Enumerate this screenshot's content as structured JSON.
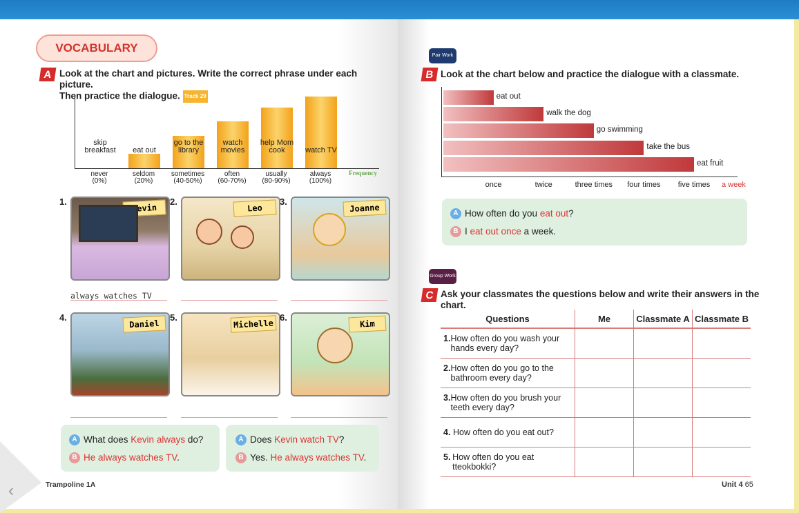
{
  "left_page": {
    "vocab_title": "VOCABULARY",
    "section_a": {
      "badge": "A",
      "line1": "Look at the chart and pictures. Write the correct phrase under each picture.",
      "line2": "Then practice the dialogue.",
      "track": "Track 29"
    },
    "frequency_label": "Frequency",
    "footer": "Trampoline 1A",
    "pictures": [
      {
        "num": "1.",
        "name": "Kevin",
        "answer": "always watches TV"
      },
      {
        "num": "2.",
        "name": "Leo",
        "answer": ""
      },
      {
        "num": "3.",
        "name": "Joanne",
        "answer": ""
      },
      {
        "num": "4.",
        "name": "Daniel",
        "answer": ""
      },
      {
        "num": "5.",
        "name": "Michelle",
        "answer": ""
      },
      {
        "num": "6.",
        "name": "Kim",
        "answer": ""
      }
    ],
    "dialogue1": {
      "q_prefix": "What does ",
      "q_highlight": "Kevin always",
      "q_suffix": " do?",
      "a_highlight": "He always watches TV",
      "a_suffix": "."
    },
    "dialogue2": {
      "q_prefix": "Does ",
      "q_highlight": "Kevin watch TV",
      "q_suffix": "?",
      "a_prefix": "Yes. ",
      "a_highlight": "He always watches TV",
      "a_suffix": "."
    }
  },
  "right_page": {
    "pair_work": "Pair Work",
    "group_work": "Group Work",
    "section_b": {
      "badge": "B",
      "text": "Look at the chart below and practice the dialogue with a classmate."
    },
    "dialogue_b": {
      "q_prefix": "How often do you ",
      "q_highlight": "eat out",
      "q_suffix": "?",
      "a_prefix": "I ",
      "a_highlight": "eat out once",
      "a_suffix": " a week."
    },
    "section_c": {
      "badge": "C",
      "text": "Ask your classmates the questions below and write their answers in the chart."
    },
    "table_headers": [
      "Questions",
      "Me",
      "Classmate A",
      "Classmate B"
    ],
    "questions": [
      {
        "num": "1.",
        "text": "How often do you wash your hands every day?"
      },
      {
        "num": "2.",
        "text": "How often do you go to the bathroom every day?"
      },
      {
        "num": "3.",
        "text": "How often do you brush your teeth every day?"
      },
      {
        "num": "4.",
        "text": "How often do you eat out?"
      },
      {
        "num": "5.",
        "text": "How often do you eat tteokbokki?"
      }
    ],
    "footer_unit": "Unit 4",
    "footer_page": "65"
  },
  "chart_data": [
    {
      "type": "bar",
      "categories": [
        "never\n(0%)",
        "seldom\n(20%)",
        "sometimes\n(40-50%)",
        "often\n(60-70%)",
        "usually\n(80-90%)",
        "always\n(100%)"
      ],
      "bar_labels": [
        "skip\nbreakfast",
        "eat out",
        "go to the\nlibrary",
        "watch\nmovies",
        "help Mom\ncook",
        "watch TV"
      ],
      "values": [
        0,
        20,
        45,
        65,
        85,
        100
      ],
      "xlabel": "Frequency",
      "ylim": [
        0,
        100
      ]
    },
    {
      "type": "bar",
      "orientation": "horizontal",
      "categories": [
        "eat out",
        "walk the dog",
        "go swimming",
        "take the bus",
        "eat fruit"
      ],
      "values": [
        1,
        2,
        3,
        4,
        5
      ],
      "x_ticks": [
        "once",
        "twice",
        "three times",
        "four times",
        "five times"
      ],
      "xlabel": "a week",
      "xlim": [
        0,
        5
      ]
    }
  ]
}
